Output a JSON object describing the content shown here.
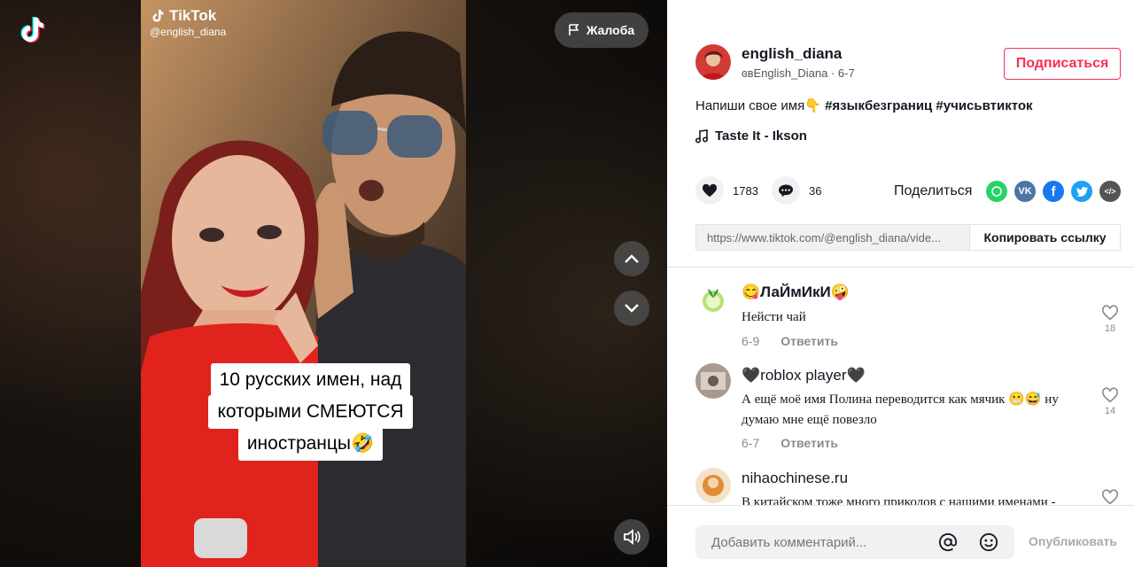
{
  "app": {
    "name": "TikTok",
    "logo_icon": "tiktok-logo-icon"
  },
  "video": {
    "watermark": {
      "brand": "TikTok",
      "handle": "@english_diana"
    },
    "caption": [
      "10 русских имен, над",
      "которыми СМЕЮТСЯ",
      "иностранцы🤣"
    ],
    "report_label": "Жалоба",
    "icons": {
      "report": "flag-icon",
      "prev": "chevron-up-icon",
      "next": "chevron-down-icon",
      "sound": "volume-icon"
    }
  },
  "author": {
    "username": "english_diana",
    "nickname": "ɞвEnglish_Diana",
    "date": "6-7",
    "follow_label": "Подписаться"
  },
  "post": {
    "text": "Напиши свое имя👇 ",
    "hashtags": "#языкбезграниц #учисьвтикток",
    "music": "Taste It - Ikson"
  },
  "actions": {
    "likes": "1783",
    "comments": "36",
    "share_label": "Поделиться",
    "share_targets": [
      {
        "name": "whatsapp-icon",
        "color": "#25d366"
      },
      {
        "name": "vk-icon",
        "color": "#4c75a3"
      },
      {
        "name": "facebook-icon",
        "color": "#1877f2"
      },
      {
        "name": "twitter-icon",
        "color": "#1da1f2"
      },
      {
        "name": "embed-icon",
        "color": "#555555"
      }
    ]
  },
  "link": {
    "url": "https://www.tiktok.com/@english_diana/vide...",
    "copy_label": "Копировать ссылку"
  },
  "comments": [
    {
      "name": "😋ЛаЙмИкИ🤪",
      "text": "Нейсти чай",
      "date": "6-9",
      "reply": "Ответить",
      "likes": "18"
    },
    {
      "name": "🖤roblox player🖤",
      "text": "А ещё моё имя Полина переводится как мячик 😬😅 ну думаю мне ещё повезло",
      "date": "6-7",
      "reply": "Ответить",
      "likes": "14"
    },
    {
      "name": "nihaochinese.ru",
      "text": "В китайском тоже много приколов с нашими именами -",
      "date": "",
      "reply": "",
      "likes": ""
    }
  ],
  "composer": {
    "placeholder": "Добавить комментарий...",
    "publish_label": "Опубликовать",
    "icons": [
      "at-icon",
      "emoji-icon"
    ]
  },
  "colors": {
    "accent": "#fe2c55",
    "text": "#161823",
    "muted": "#8a8b91"
  }
}
